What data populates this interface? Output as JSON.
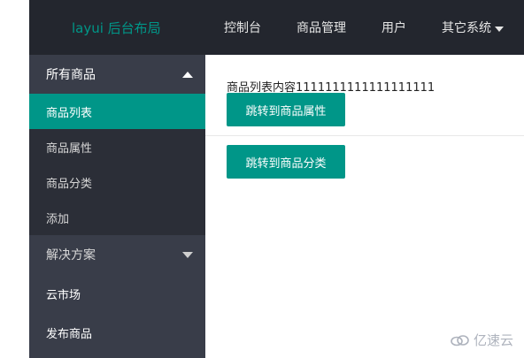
{
  "header": {
    "logo": "layui 后台布局",
    "nav": [
      {
        "label": "控制台"
      },
      {
        "label": "商品管理"
      },
      {
        "label": "用户"
      },
      {
        "label": "其它系统"
      }
    ]
  },
  "sidebar": {
    "group1": {
      "label": "所有商品",
      "items": [
        {
          "label": "商品列表"
        },
        {
          "label": "商品属性"
        },
        {
          "label": "商品分类"
        },
        {
          "label": "添加"
        }
      ]
    },
    "group2": {
      "label": "解决方案"
    },
    "items": [
      {
        "label": "云市场"
      },
      {
        "label": "发布商品"
      }
    ]
  },
  "content": {
    "text": "商品列表内容1111111111111111111",
    "button1": "跳转到商品属性",
    "button2": "跳转到商品分类"
  },
  "watermark": "亿速云",
  "colors": {
    "header_bg": "#23262e",
    "sidebar_bg": "#393d49",
    "submenu_bg": "#2b2e37",
    "accent": "#009688"
  }
}
